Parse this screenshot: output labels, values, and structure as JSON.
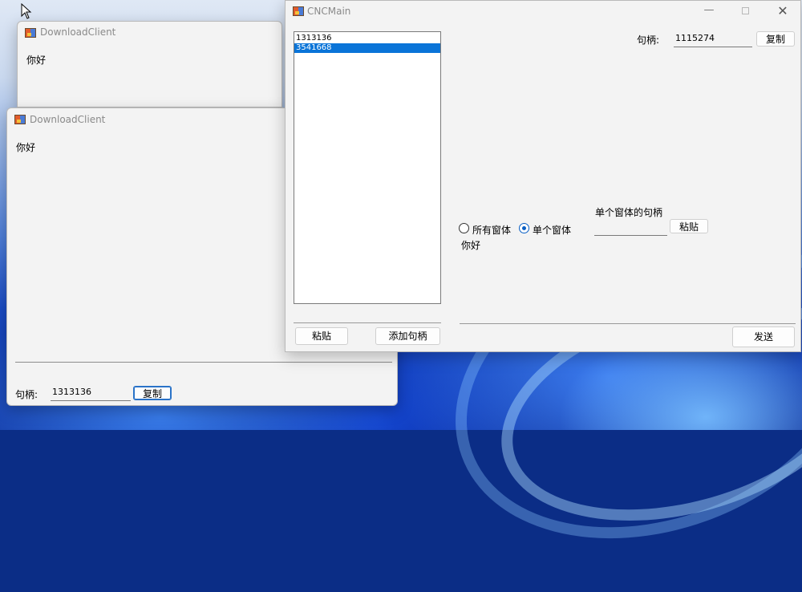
{
  "windows": {
    "download_client_back": {
      "title": "DownloadClient",
      "message": "你好"
    },
    "download_client_front": {
      "title": "DownloadClient",
      "message": "你好",
      "handle_label": "句柄:",
      "handle_value": "1313136",
      "copy_label": "复制"
    },
    "cnc_main": {
      "title": "CNCMain",
      "handle_list": [
        "1313136",
        "3541668"
      ],
      "selected_index": 1,
      "paste_label": "粘贴",
      "add_handle_label": "添加句柄",
      "handle_label": "句柄:",
      "handle_value": "1115274",
      "copy_label": "复制",
      "radio_all_label": "所有窗体",
      "radio_single_label": "单个窗体",
      "radio_selected": "single",
      "message": "你好",
      "single_handle_title": "单个窗体的句柄",
      "single_handle_value": "",
      "single_paste_label": "粘贴",
      "send_label": "发送"
    }
  },
  "colors": {
    "selection": "#0a74d8",
    "window_bg": "#f3f3f3",
    "radio_accent": "#0a5fc4"
  }
}
